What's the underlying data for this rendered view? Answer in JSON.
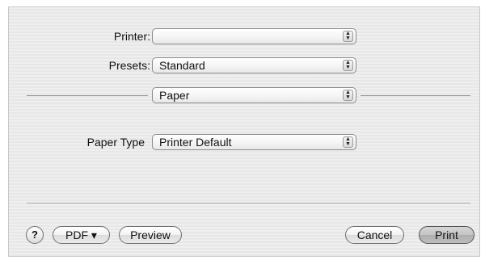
{
  "printer": {
    "label": "Printer:",
    "value": ""
  },
  "presets": {
    "label": "Presets:",
    "value": "Standard"
  },
  "panel": {
    "value": "Paper"
  },
  "paper_type": {
    "label": "Paper Type",
    "value": "Printer Default"
  },
  "buttons": {
    "help": "?",
    "pdf": "PDF ▾",
    "preview": "Preview",
    "cancel": "Cancel",
    "print": "Print"
  },
  "icons": {
    "popup_arrows": "up-down-arrows-icon",
    "help": "question-icon"
  }
}
